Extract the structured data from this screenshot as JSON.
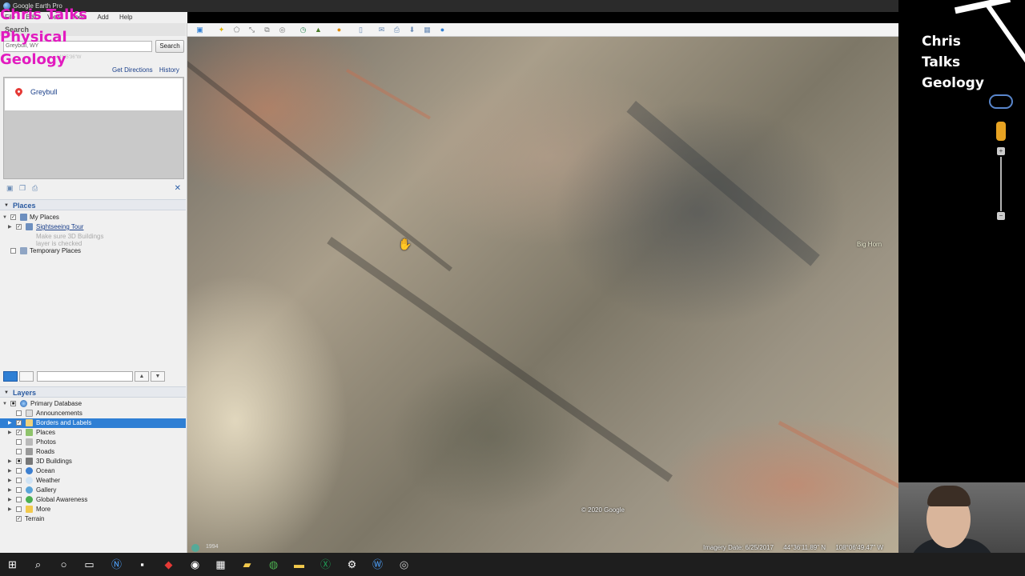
{
  "window": {
    "title": "Google Earth Pro"
  },
  "menu": [
    "File",
    "Edit",
    "View",
    "Tools",
    "Add",
    "Help"
  ],
  "search": {
    "header": "Search",
    "value": "Greybull, WY",
    "button": "Search",
    "ghost_coord": "44°35'36\"W",
    "links": {
      "directions": "Get Directions",
      "history": "History"
    },
    "results": [
      "Greybull"
    ]
  },
  "places": {
    "header": "Places",
    "items": [
      {
        "label": "My Places",
        "checked": true
      },
      {
        "label": "Sightseeing Tour",
        "checked": true
      },
      {
        "label": "Make sure 3D Buildings"
      },
      {
        "label": "layer is checked"
      },
      {
        "label": "Temporary Places",
        "checked": false
      }
    ]
  },
  "layers": {
    "header": "Layers",
    "items": [
      {
        "label": "Primary Database"
      },
      {
        "label": "Announcements"
      },
      {
        "label": "Borders and Labels",
        "selected": true
      },
      {
        "label": "Places"
      },
      {
        "label": "Photos"
      },
      {
        "label": "Roads"
      },
      {
        "label": "3D Buildings"
      },
      {
        "label": "Ocean"
      },
      {
        "label": "Weather"
      },
      {
        "label": "Gallery"
      },
      {
        "label": "Global Awareness"
      },
      {
        "label": "More"
      },
      {
        "label": "Terrain"
      }
    ]
  },
  "map": {
    "place_label": "Big Horn",
    "copyright": "© 2020 Google",
    "year": "1994",
    "imagery_date": "Imagery Date: 6/25/2017",
    "lat": "44°36'11.89\" N",
    "lon": "108°06'49.47\" W"
  },
  "overlay": {
    "watermark": [
      "Chris Talks",
      "Physical",
      "Geology"
    ],
    "brand": [
      "Chris",
      "Talks",
      "Geology"
    ]
  },
  "colors": {
    "selection": "#2f7fd4",
    "link": "#1a3f8a",
    "watermark": "#e21bbf"
  }
}
